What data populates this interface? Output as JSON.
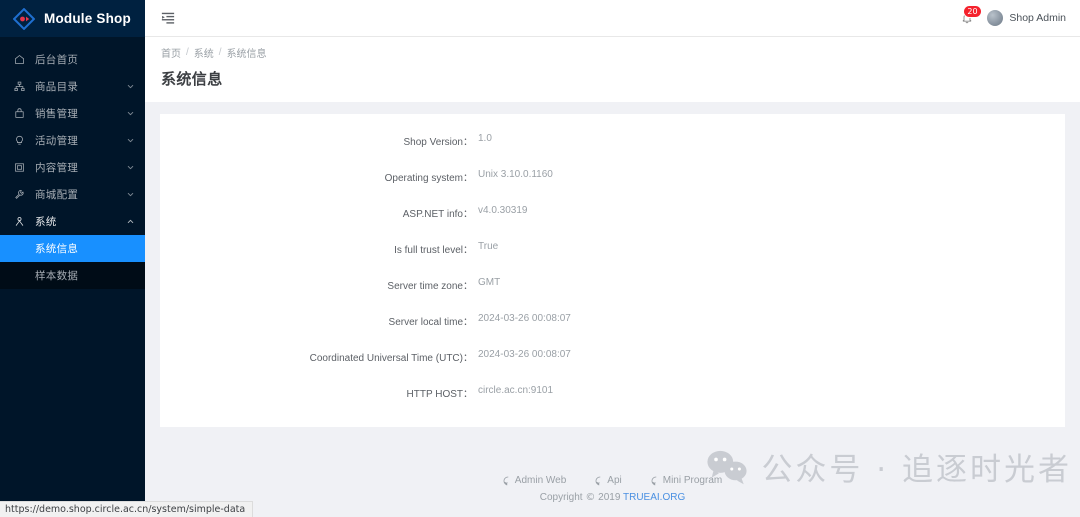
{
  "sidebar": {
    "logo": {
      "text": "Module Shop",
      "icon": "diamond-logo-icon",
      "color": "#1f6fd0"
    },
    "items": [
      {
        "label": "后台首页",
        "icon": "home-icon",
        "has_children": false
      },
      {
        "label": "商品目录",
        "icon": "sitemap-icon",
        "has_children": true
      },
      {
        "label": "销售管理",
        "icon": "shopping-bag-icon",
        "has_children": true
      },
      {
        "label": "活动管理",
        "icon": "bulb-icon",
        "has_children": true
      },
      {
        "label": "内容管理",
        "icon": "window-icon",
        "has_children": true
      },
      {
        "label": "商城配置",
        "icon": "wrench-icon",
        "has_children": true
      },
      {
        "label": "系统",
        "icon": "user-system-icon",
        "has_children": true,
        "expanded": true
      }
    ],
    "submenu": [
      {
        "label": "系统信息",
        "active": true
      },
      {
        "label": "样本数据",
        "active": false
      }
    ],
    "active_color": "#1890ff"
  },
  "topbar": {
    "fold_icon": "menu-fold-icon",
    "bell_icon": "bell-icon",
    "notification_count": "20",
    "user_name": "Shop Admin",
    "avatar_icon": "avatar-icon"
  },
  "page": {
    "breadcrumb": [
      "首页",
      "系统",
      "系统信息"
    ],
    "breadcrumb_separator": "/",
    "title": "系统信息"
  },
  "system_info": [
    {
      "label": "Shop Version：",
      "value": "1.0"
    },
    {
      "label": "Operating system：",
      "value": "Unix 3.10.0.1160"
    },
    {
      "label": "ASP.NET info：",
      "value": "v4.0.30319"
    },
    {
      "label": "Is full trust level：",
      "value": "True"
    },
    {
      "label": "Server time zone：",
      "value": "GMT"
    },
    {
      "label": "Server local time：",
      "value": "2024-03-26 00:08:07"
    },
    {
      "label": "Coordinated Universal Time (UTC)：",
      "value": "2024-03-26 00:08:07"
    },
    {
      "label": "HTTP HOST：",
      "value": "circle.ac.cn:9101"
    }
  ],
  "footer": {
    "links": [
      {
        "label": "Admin Web",
        "icon": "github-icon"
      },
      {
        "label": "Api",
        "icon": "github-icon"
      },
      {
        "label": "Mini Program",
        "icon": "github-icon"
      }
    ],
    "copyright_prefix": "Copyright",
    "copyright_mark": "©",
    "copyright_year": "2019",
    "copyright_brand": "TRUEAI.ORG",
    "brand_color": "#4a90e2"
  },
  "watermark": {
    "icon": "wechat-icon",
    "text": "公众号 · 追逐时光者"
  },
  "statusbar": {
    "url": "https://demo.shop.circle.ac.cn/system/simple-data"
  }
}
